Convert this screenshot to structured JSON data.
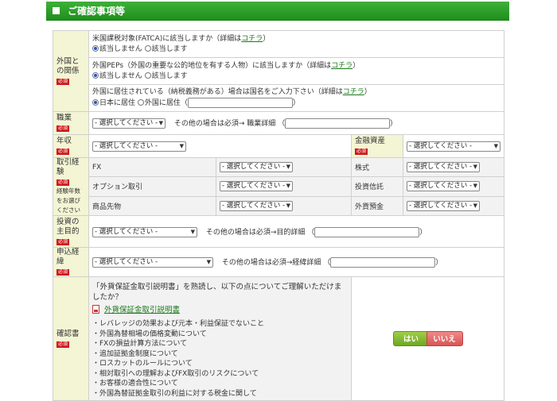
{
  "header": {
    "title": "ご確認事項等"
  },
  "foreign": {
    "label": "外国との関係",
    "req": "必須",
    "fatca": {
      "q": "米国課税対象(FATCA)に該当しますか（詳細は",
      "link": "コチラ",
      "tail": "）",
      "opt1": "該当しません",
      "opt2": "該当します"
    },
    "peps": {
      "q": "外国PEPs（外国の重要な公的地位を有する人物）に該当しますか（詳細は",
      "link": "コチラ",
      "tail": "）",
      "opt1": "該当しません",
      "opt2": "該当します"
    },
    "reside": {
      "q": "外国に居住されている（納税義務がある）場合は国名をご入力下さい（詳細は",
      "link": "コチラ",
      "tail": "）",
      "opt1": "日本に居住",
      "opt2": "外国に居住（",
      "close": "）"
    }
  },
  "job": {
    "label": "職業",
    "req": "必須",
    "select": "- 選択してください -",
    "note": "その他の場合は必須→ 職業詳細 （",
    "close": "）"
  },
  "income": {
    "label": "年収",
    "req": "必須",
    "select": "- 選択してください -",
    "asset_label": "金融資産",
    "asset_req": "必須",
    "asset_select": "- 選択してください -"
  },
  "experience": {
    "label": "取引経験",
    "req": "必須",
    "sub": "経験年数をお選びください",
    "rows": [
      {
        "a": "FX",
        "a_sel": "- 選択してください -",
        "b": "株式",
        "b_sel": "- 選択してください -"
      },
      {
        "a": "オプション取引",
        "a_sel": "- 選択してください -",
        "b": "投資信託",
        "b_sel": "- 選択してください -"
      },
      {
        "a": "商品先物",
        "a_sel": "- 選択してください -",
        "b": "外貨預金",
        "b_sel": "- 選択してください -"
      }
    ]
  },
  "purpose": {
    "label": "投資の主目的",
    "req": "必須",
    "select": "- 選択してください -",
    "note": "その他の場合は必須→目的詳細 （",
    "close": "）"
  },
  "route": {
    "label": "申込経緯",
    "req": "必須",
    "select": "- 選択してください -",
    "note": "その他の場合は必須→経緯詳細 （",
    "close": "）"
  },
  "confirm": {
    "label": "確認書",
    "req": "必須",
    "intro": "「外貨保証金取引説明書」を熟読し、以下の点についてご理解いただけましたか？",
    "doc_link": "外貨保証金取引説明書",
    "items": [
      "・レバレッジの効果および元本・利益保証でないこと",
      "・外国為替相場の価格変動について",
      "・FXの損益計算方法について",
      "・追加証拠金制度について",
      "・ロスカットのルールについて",
      "・相対取引への理解およびFX取引のリスクについて",
      "・お客様の適合性について",
      "・外国為替証拠金取引の利益に対する税金に関して"
    ],
    "yes": "はい",
    "no": "いいえ"
  }
}
